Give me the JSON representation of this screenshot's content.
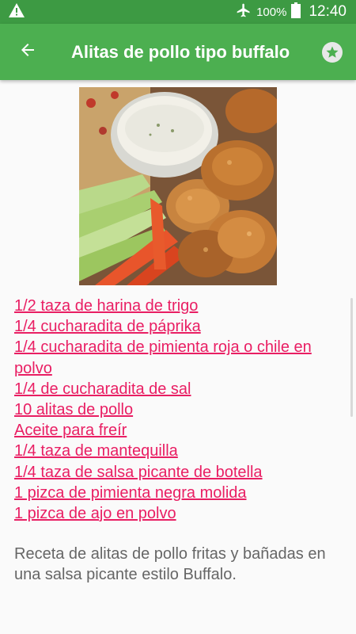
{
  "status_bar": {
    "battery": "100%",
    "time": "12:40",
    "icons": [
      "warning-icon",
      "airplane-mode-icon",
      "battery-icon"
    ]
  },
  "app_bar": {
    "title": "Alitas de pollo tipo buffalo",
    "back_icon": "arrow-back-icon",
    "favorite_icon": "star-icon",
    "color": "#4caf50",
    "status_color": "#3d9a43"
  },
  "recipe": {
    "image": "chicken-wings-photo",
    "ingredients": [
      "1/2 taza de harina de trigo",
      "1/4 cucharadita de páprika",
      "1/4 cucharadita de pimienta roja o chile en polvo",
      "1/4 de cucharadita de sal",
      "10 alitas de pollo",
      "Aceite para freír",
      "1/4 taza de mantequilla",
      "1/4 taza de salsa picante de botella",
      "1 pizca de pimienta negra molida",
      "1 pizca de ajo en polvo"
    ],
    "description": "Receta de alitas de pollo fritas y bañadas en una salsa picante estilo Buffalo.",
    "link_color": "#e91e63"
  }
}
